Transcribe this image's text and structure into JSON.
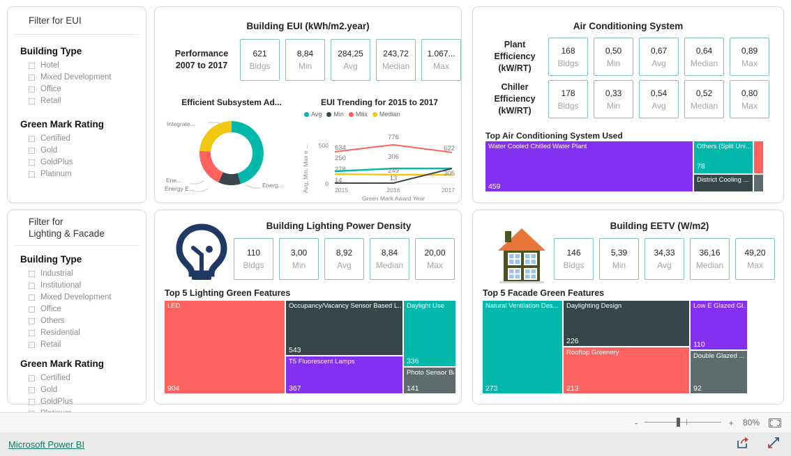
{
  "filters": {
    "eui": {
      "title": "Filter for EUI",
      "groups": [
        {
          "title": "Building Type",
          "items": [
            "Hotel",
            "Mixed Development",
            "Office",
            "Retail"
          ]
        },
        {
          "title": "Green Mark Rating",
          "items": [
            "Certified",
            "Gold",
            "GoldPlus",
            "Platinum"
          ]
        }
      ]
    },
    "lighting_facade": {
      "title_line1": "Filter for",
      "title_line2": "Lighting & Facade",
      "groups": [
        {
          "title": "Building Type",
          "items": [
            "Industrial",
            "Institutional",
            "Mixed Development",
            "Office",
            "Others",
            "Residential",
            "Retail"
          ]
        },
        {
          "title": "Green Mark Rating",
          "items": [
            "Certified",
            "Gold",
            "GoldPlus",
            "Platinum"
          ]
        }
      ]
    }
  },
  "eui_panel": {
    "title": "Building EUI (kWh/m2.year)",
    "side_label_line1": "Performance",
    "side_label_line2": "2007 to 2017",
    "kpis": [
      {
        "value": "621",
        "label": "Bldgs"
      },
      {
        "value": "8,84",
        "label": "Min"
      },
      {
        "value": "284,25",
        "label": "Avg"
      },
      {
        "value": "243,72",
        "label": "Median"
      },
      {
        "value": "1.067...",
        "label": "Max"
      }
    ],
    "donut_title": "Efficient Subsystem Ad...",
    "trend_title": "EUI Trending for 2015 to 2017"
  },
  "ac_panel": {
    "title": "Air Conditioning System",
    "rows": [
      {
        "label_lines": [
          "Plant",
          "Efficiency",
          "(kW/RT)"
        ],
        "kpis": [
          {
            "value": "168",
            "label": "Bldgs"
          },
          {
            "value": "0,50",
            "label": "Min"
          },
          {
            "value": "0,67",
            "label": "Avg"
          },
          {
            "value": "0,64",
            "label": "Median"
          },
          {
            "value": "0,89",
            "label": "Max"
          }
        ]
      },
      {
        "label_lines": [
          "Chiller",
          "Efficiency",
          "(kW/RT)"
        ],
        "kpis": [
          {
            "value": "178",
            "label": "Bldgs"
          },
          {
            "value": "0,33",
            "label": "Min"
          },
          {
            "value": "0,54",
            "label": "Avg"
          },
          {
            "value": "0,52",
            "label": "Median"
          },
          {
            "value": "0,80",
            "label": "Max"
          }
        ]
      }
    ],
    "treemap_title": "Top Air Conditioning System Used"
  },
  "lighting_panel": {
    "title": "Building Lighting Power Density",
    "icon": "lightbulb-icon",
    "kpis": [
      {
        "value": "110",
        "label": "Bldgs"
      },
      {
        "value": "3,00",
        "label": "Min"
      },
      {
        "value": "8,92",
        "label": "Avg"
      },
      {
        "value": "8,84",
        "label": "Median"
      },
      {
        "value": "20,00",
        "label": "Max"
      }
    ],
    "treemap_title": "Top 5 Lighting Green Features"
  },
  "eetv_panel": {
    "title": "Building EETV (W/m2)",
    "icon": "house-icon",
    "kpis": [
      {
        "value": "146",
        "label": "Bldgs"
      },
      {
        "value": "5,39",
        "label": "Min"
      },
      {
        "value": "34,33",
        "label": "Avg"
      },
      {
        "value": "36,16",
        "label": "Median"
      },
      {
        "value": "49,20",
        "label": "Max"
      }
    ],
    "treemap_title": "Top 5 Facade Green Features"
  },
  "statusbar": {
    "minus": "-",
    "plus": "+",
    "zoom_level": "80%",
    "fit_icon": "fit-to-page-icon"
  },
  "footer": {
    "brand": "Microsoft Power BI",
    "share_icon": "share-icon",
    "fullscreen_icon": "fullscreen-icon"
  },
  "palette": {
    "teal": "#01B8AA",
    "dark": "#374649",
    "red": "#FD625E",
    "yellow": "#F2C80F",
    "purple": "#8430F0",
    "gray": "#5F6B6D",
    "kpi_border": "#7fc4bd",
    "link": "#117865"
  },
  "chart_data": [
    {
      "type": "pie",
      "title": "Efficient Subsystem Ad...",
      "legend": "labels",
      "labels": [
        "Energ...",
        "Integrate...",
        "Ene...",
        "Energy E..."
      ],
      "values": [
        52,
        23,
        17,
        8
      ],
      "colors": [
        "#01B8AA",
        "#F2C80F",
        "#FD625E",
        "#374649"
      ]
    },
    {
      "type": "line",
      "title": "EUI Trending for 2015 to 2017",
      "xlabel": "Green Mark Award Year",
      "ylabel": "Avg, Min, Max e ...",
      "x": [
        "2015",
        "2016",
        "2017"
      ],
      "ylim": [
        0,
        900
      ],
      "yticks": [
        "0",
        "500"
      ],
      "legend": [
        "Avg",
        "Min",
        "Max",
        "Median"
      ],
      "series": [
        {
          "name": "Avg",
          "values": [
            250,
            306,
            306
          ],
          "color": "#01B8AA"
        },
        {
          "name": "Min",
          "values": [
            14,
            13,
            305
          ],
          "color": "#374649"
        },
        {
          "name": "Max",
          "values": [
            634,
            776,
            622
          ],
          "color": "#FD625E"
        },
        {
          "name": "Median",
          "values": [
            278,
            249,
            249
          ],
          "color": "#F2C80F"
        }
      ],
      "point_labels": [
        "634",
        "250",
        "278",
        "14",
        "776",
        "306",
        "249",
        "13",
        "622",
        "305"
      ]
    },
    {
      "type": "treemap",
      "title": "Top Air Conditioning System Used",
      "nodes": [
        {
          "name": "Water Cooled Chilled Water Plant",
          "value": "459",
          "color": "#8430F0"
        },
        {
          "name": "Others (Split Uni...",
          "value": "78",
          "color": "#01B8AA"
        },
        {
          "name": "District Cooling ...",
          "value": "",
          "color": "#374649"
        },
        {
          "name": "",
          "value": "",
          "color": "#FD625E"
        },
        {
          "name": "",
          "value": "",
          "color": "#5F6B6D"
        }
      ]
    },
    {
      "type": "treemap",
      "title": "Top 5 Lighting Green Features",
      "nodes": [
        {
          "name": "LED",
          "value": "904",
          "color": "#FD625E"
        },
        {
          "name": "Occupancy/Vacancy Sensor Based L...",
          "value": "543",
          "color": "#374649"
        },
        {
          "name": "T5 Fluorescent Lamps",
          "value": "367",
          "color": "#8430F0"
        },
        {
          "name": "Daylight Use",
          "value": "336",
          "color": "#01B8AA"
        },
        {
          "name": "Photo Sensor Ba...",
          "value": "141",
          "color": "#5F6B6D"
        }
      ]
    },
    {
      "type": "treemap",
      "title": "Top 5 Facade Green Features",
      "nodes": [
        {
          "name": "Natural Ventilation Des...",
          "value": "273",
          "color": "#01B8AA"
        },
        {
          "name": "Daylighting Design",
          "value": "226",
          "color": "#374649"
        },
        {
          "name": "Rooftop Greenery",
          "value": "213",
          "color": "#FD625E"
        },
        {
          "name": "Low E Glazed Gl...",
          "value": "110",
          "color": "#8430F0"
        },
        {
          "name": "Double Glazed ...",
          "value": "92",
          "color": "#5F6B6D"
        }
      ]
    }
  ]
}
